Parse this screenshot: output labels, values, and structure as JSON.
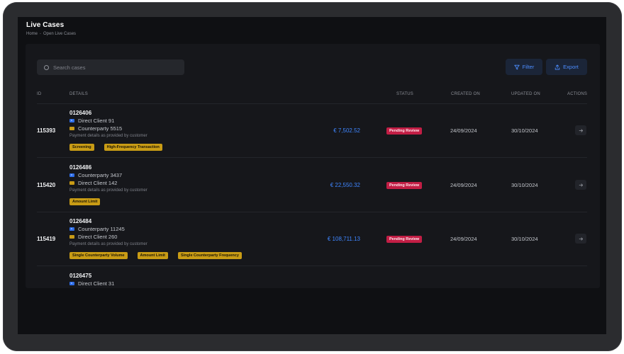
{
  "header": {
    "title": "Live Cases",
    "breadcrumb": [
      "Home",
      "Open Live Cases"
    ],
    "breadcrumb_sep": "-"
  },
  "toolbar": {
    "search_placeholder": "Search cases",
    "search_value": "",
    "filter_label": "Filter",
    "export_label": "Export"
  },
  "table": {
    "columns": {
      "id": "ID",
      "details": "DETAILS",
      "status": "STATUS",
      "created": "CREATED ON",
      "updated": "UPDATED ON",
      "actions": "ACTIONS"
    },
    "rows": [
      {
        "id": "115393",
        "case_no": "0126406",
        "party_blue": "Direct Client 91",
        "party_yellow": "Counterparty 5515",
        "desc": "Payment details as provided by customer",
        "tags": [
          "Screening",
          "High-Frequency Transaction"
        ],
        "amount": "€ 7,502.52",
        "status": "Pending Review",
        "created": "24/09/2024",
        "updated": "30/10/2024"
      },
      {
        "id": "115420",
        "case_no": "0126486",
        "party_blue": "Counterparty 3437",
        "party_yellow": "Direct Client 142",
        "desc": "Payment details as provided by customer",
        "tags": [
          "Amount Limit"
        ],
        "amount": "€ 22,550.32",
        "status": "Pending Review",
        "created": "24/09/2024",
        "updated": "30/10/2024"
      },
      {
        "id": "115419",
        "case_no": "0126484",
        "party_blue": "Counterparty 11245",
        "party_yellow": "Direct Client 260",
        "desc": "Payment details as provided by customer",
        "tags": [
          "Single Counterparty Volume",
          "Amount Limit",
          "Single Counterparty Frequency"
        ],
        "amount": "€ 108,711.13",
        "status": "Pending Review",
        "created": "24/09/2024",
        "updated": "30/10/2024"
      },
      {
        "case_no": "0126475",
        "party_blue": "Direct Client 31"
      }
    ]
  },
  "colors": {
    "accent": "#3f86ff",
    "tag": "#c99c15",
    "status_pending": "#c21e45",
    "background": "#0f1013"
  },
  "icons": {
    "search": "search-icon",
    "filter": "filter-icon",
    "export": "export-icon",
    "action": "arrow-right-icon"
  }
}
